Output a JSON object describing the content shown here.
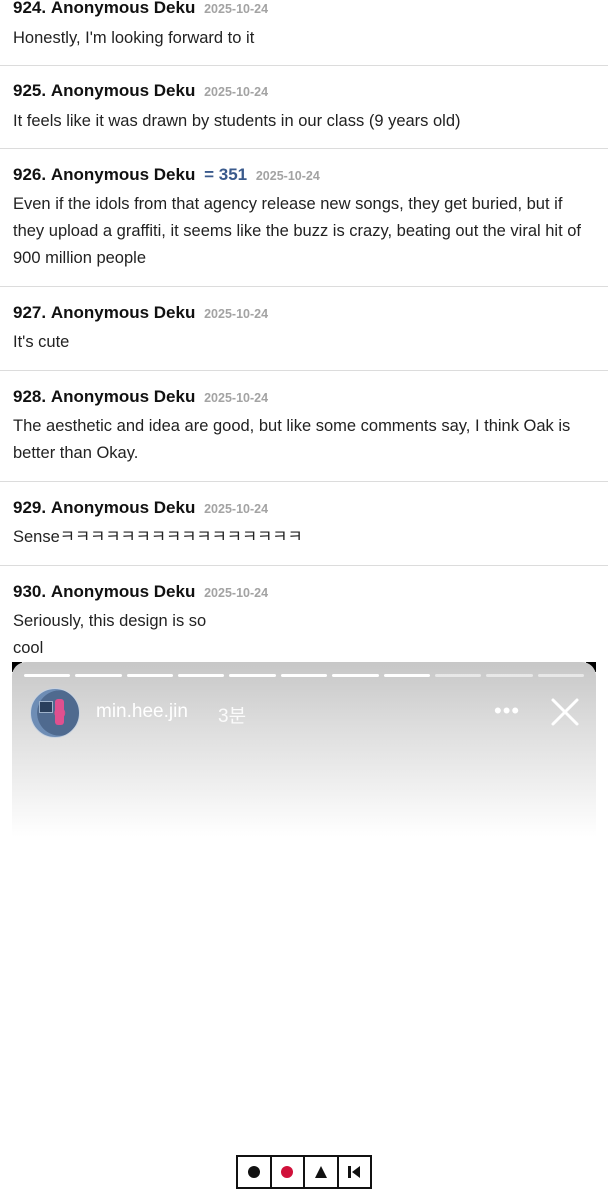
{
  "comments": [
    {
      "num": "924.",
      "author": "Anonymous Deku",
      "date": "2025-10-24",
      "text": "Honestly, I'm looking forward to it"
    },
    {
      "num": "925.",
      "author": "Anonymous Deku",
      "date": "2025-10-24",
      "text": "It feels like it was drawn by students in our class (9 years old)"
    },
    {
      "num": "926.",
      "author": "Anonymous Deku",
      "score": "= 351",
      "date": "2025-10-24",
      "text": "Even if the idols from that agency release new songs, they get buried, but if they upload a graffiti, it seems like the buzz is crazy, beating out the viral hit of 900 million people"
    },
    {
      "num": "927.",
      "author": "Anonymous Deku",
      "date": "2025-10-24",
      "text": "It's cute"
    },
    {
      "num": "928.",
      "author": "Anonymous Deku",
      "date": "2025-10-24",
      "text": "The aesthetic and idea are good, but like some comments say, I think Oak is better than Okay."
    },
    {
      "num": "929.",
      "author": "Anonymous Deku",
      "date": "2025-10-24",
      "text": "Senseㅋㅋㅋㅋㅋㅋㅋㅋㅋㅋㅋㅋㅋㅋㅋㅋ"
    },
    {
      "num": "930.",
      "author": "Anonymous Deku",
      "date": "2025-10-24",
      "text_line1": "Seriously, this design is so",
      "text_line2": "cool"
    }
  ],
  "story": {
    "username": "min.hee.jin",
    "ago": "3분",
    "progress_segments": 11,
    "progress_completed": 8,
    "more_icon": "more-dots-icon",
    "close_icon": "close-icon"
  },
  "controls": [
    {
      "icon": "black-dot-icon",
      "color": "#111111"
    },
    {
      "icon": "red-dot-icon",
      "color": "#d0103a"
    },
    {
      "icon": "triangle-icon",
      "color": "#111111"
    },
    {
      "icon": "skip-back-icon",
      "color": "#111111"
    }
  ]
}
